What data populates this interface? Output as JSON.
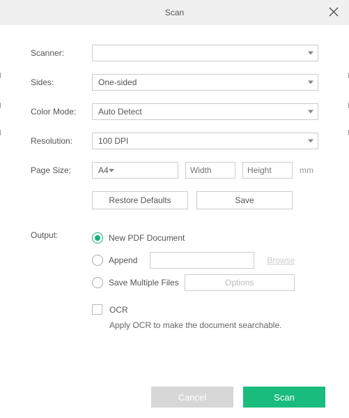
{
  "title": "Scan",
  "labels": {
    "scanner": "Scanner:",
    "sides": "Sides:",
    "colormode": "Color Mode:",
    "resolution": "Resolution:",
    "pagesize": "Page Size:",
    "output": "Output:"
  },
  "values": {
    "scanner": "",
    "sides": "One-sided",
    "colormode": "Auto Detect",
    "resolution": "100 DPI",
    "pagesize": "A4",
    "width_ph": "Width",
    "height_ph": "Height",
    "unit": "mm"
  },
  "buttons": {
    "restore": "Restore Defaults",
    "save": "Save",
    "options": "Options",
    "cancel": "Cancel",
    "scan": "Scan"
  },
  "output": {
    "newpdf": "New PDF Document",
    "append": "Append",
    "multi": "Save Multiple Files",
    "browse": "Browse"
  },
  "ocr": {
    "label": "OCR",
    "hint": "Apply OCR to make the document searchable."
  }
}
